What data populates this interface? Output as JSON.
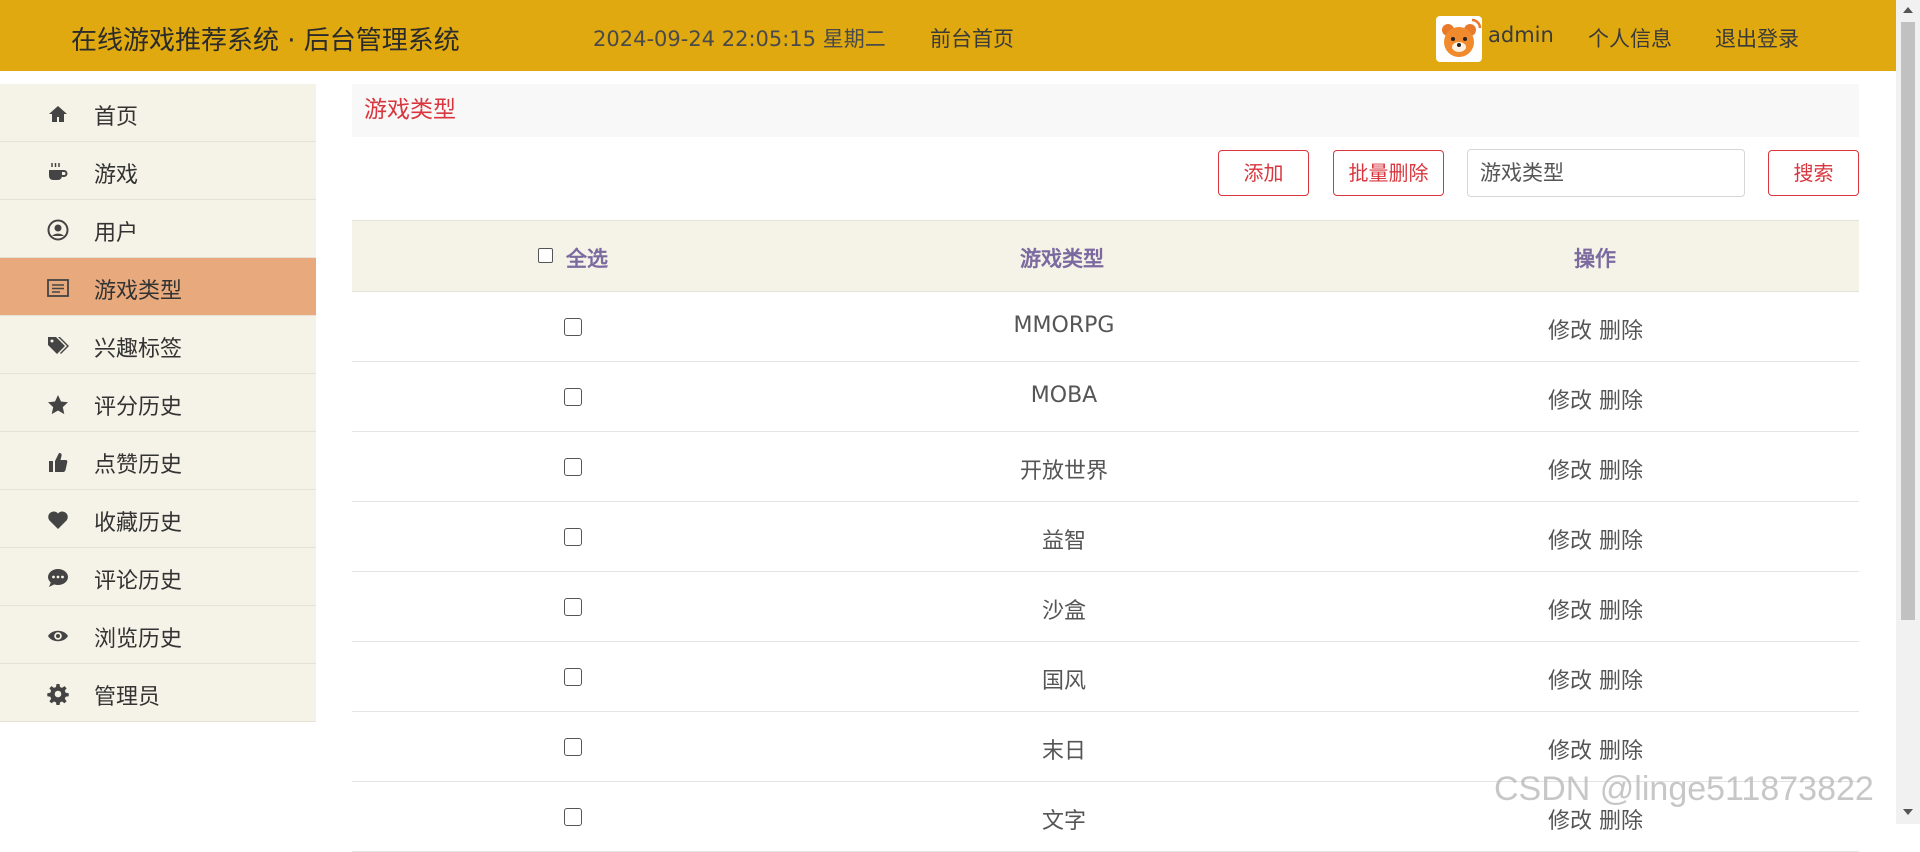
{
  "topbar": {
    "brand": "在线游戏推荐系统 · 后台管理系统",
    "datetime": "2024-09-24  22:05:15  星期二",
    "home_link": "前台首页",
    "username": "admin",
    "profile_link": "个人信息",
    "logout_link": "退出登录",
    "avatar_icon": "bear-avatar-icon"
  },
  "sidebar": {
    "items": [
      {
        "label": "首页",
        "icon": "home-icon"
      },
      {
        "label": "游戏",
        "icon": "coffee-icon"
      },
      {
        "label": "用户",
        "icon": "user-circle-icon"
      },
      {
        "label": "游戏类型",
        "icon": "list-icon",
        "active": true
      },
      {
        "label": "兴趣标签",
        "icon": "tags-icon"
      },
      {
        "label": "评分历史",
        "icon": "star-icon"
      },
      {
        "label": "点赞历史",
        "icon": "thumbs-up-icon"
      },
      {
        "label": "收藏历史",
        "icon": "heart-icon"
      },
      {
        "label": "评论历史",
        "icon": "comment-icon"
      },
      {
        "label": "浏览历史",
        "icon": "eye-icon"
      },
      {
        "label": "管理员",
        "icon": "gear-icon"
      }
    ]
  },
  "main": {
    "breadcrumb": "游戏类型",
    "toolbar": {
      "add_label": "添加",
      "batch_delete_label": "批量删除",
      "search_placeholder": "游戏类型",
      "search_label": "搜索"
    },
    "table": {
      "headers": {
        "select_all": "全选",
        "type": "游戏类型",
        "actions": "操作"
      },
      "rows": [
        {
          "name": "MMORPG",
          "edit": "修改",
          "delete": "删除"
        },
        {
          "name": "MOBA",
          "edit": "修改",
          "delete": "删除"
        },
        {
          "name": "开放世界",
          "edit": "修改",
          "delete": "删除"
        },
        {
          "name": "益智",
          "edit": "修改",
          "delete": "删除"
        },
        {
          "name": "沙盒",
          "edit": "修改",
          "delete": "删除"
        },
        {
          "name": "国风",
          "edit": "修改",
          "delete": "删除"
        },
        {
          "name": "末日",
          "edit": "修改",
          "delete": "删除"
        },
        {
          "name": "文字",
          "edit": "修改",
          "delete": "删除"
        }
      ]
    }
  },
  "watermark": "CSDN @linge511873822",
  "colors": {
    "topbar": "#dfa90f",
    "accent_red": "#d9363e",
    "sidebar_bg": "#f5f3e7",
    "sidebar_active": "#e8aa7c",
    "header_text": "#7b6aa0"
  }
}
